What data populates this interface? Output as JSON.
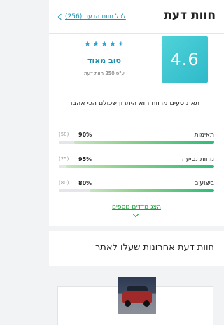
{
  "header": {
    "title": "חוות דעת",
    "all_reviews_link": "לכל חוות הדעת (256)"
  },
  "score": {
    "value": "4.6",
    "stars": 4.5,
    "label": "טוב מאוד",
    "based_on": "ע\"פ 250 חוות דעת"
  },
  "highlight": {
    "text": "תא נוסעים מרווח הוא היתרון שכולם הכי אהבו"
  },
  "metrics": [
    {
      "label": "תאימות",
      "percent": "90%",
      "count": "(58)",
      "fill": 0.9
    },
    {
      "label": "נוחות נסיעה",
      "percent": "95%",
      "count": "(25)",
      "fill": 0.95
    },
    {
      "label": "ביצועים",
      "percent": "80%",
      "count": "(80)",
      "fill": 0.8
    }
  ],
  "more_link": "הצג מדדים נוספים",
  "recent": {
    "title": "חוות דעת אחרונות שעלו לאתר"
  },
  "colors": {
    "accent": "#1e8fb0",
    "score_bg": "#3cc6d1",
    "bar_fill": "#2fbb7a",
    "more_link": "#1e9e3a"
  }
}
